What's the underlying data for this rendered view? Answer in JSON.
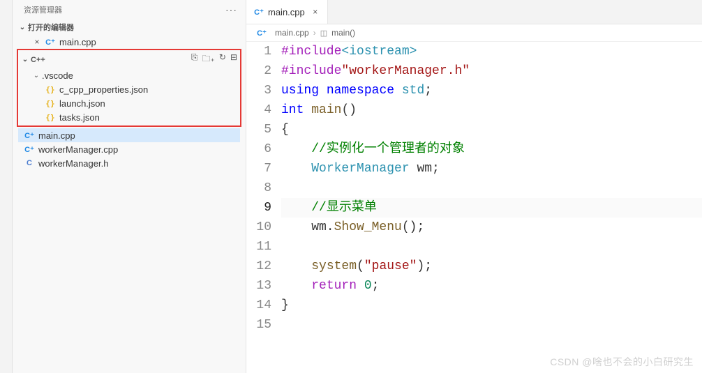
{
  "sidebar": {
    "title": "资源管理器",
    "open_editors_label": "打开的编辑器",
    "open_editor_file": "main.cpp",
    "project_name": "C++",
    "vscode_folder": ".vscode",
    "files": {
      "c_cpp_properties": "c_cpp_properties.json",
      "launch": "launch.json",
      "tasks": "tasks.json",
      "main": "main.cpp",
      "workerManagerCpp": "workerManager.cpp",
      "workerManagerH": "workerManager.h"
    }
  },
  "tab": {
    "file": "main.cpp"
  },
  "breadcrumb": {
    "file": "main.cpp",
    "symbol": "main()"
  },
  "code": {
    "lines": [
      {
        "n": 1,
        "tokens": [
          [
            "k-purple",
            "#include"
          ],
          [
            "k-teal",
            "<iostream>"
          ]
        ]
      },
      {
        "n": 2,
        "tokens": [
          [
            "k-purple",
            "#include"
          ],
          [
            "k-str",
            "\"workerManager.h\""
          ]
        ]
      },
      {
        "n": 3,
        "tokens": [
          [
            "k-blue",
            "using"
          ],
          [
            "",
            " "
          ],
          [
            "k-blue",
            "namespace"
          ],
          [
            "",
            " "
          ],
          [
            "k-teal",
            "std"
          ],
          [
            "",
            ";"
          ]
        ]
      },
      {
        "n": 4,
        "tokens": [
          [
            "k-blue",
            "int"
          ],
          [
            "",
            " "
          ],
          [
            "k-yellow",
            "main"
          ],
          [
            "",
            "()"
          ]
        ]
      },
      {
        "n": 5,
        "tokens": [
          [
            "",
            "{"
          ]
        ]
      },
      {
        "n": 6,
        "tokens": [
          [
            "",
            "    "
          ],
          [
            "k-green",
            "//实例化一个管理者的对象"
          ]
        ]
      },
      {
        "n": 7,
        "tokens": [
          [
            "",
            "    "
          ],
          [
            "k-teal",
            "WorkerManager"
          ],
          [
            "",
            " wm;"
          ]
        ]
      },
      {
        "n": 8,
        "tokens": [
          [
            "",
            ""
          ]
        ]
      },
      {
        "n": 9,
        "active": true,
        "tokens": [
          [
            "",
            "    "
          ],
          [
            "k-green",
            "//显示菜单"
          ]
        ]
      },
      {
        "n": 10,
        "tokens": [
          [
            "",
            "    wm."
          ],
          [
            "k-yellow",
            "Show_Menu"
          ],
          [
            "",
            "();"
          ]
        ]
      },
      {
        "n": 11,
        "tokens": [
          [
            "",
            ""
          ]
        ]
      },
      {
        "n": 12,
        "tokens": [
          [
            "",
            "    "
          ],
          [
            "k-yellow",
            "system"
          ],
          [
            "",
            "("
          ],
          [
            "k-str",
            "\"pause\""
          ],
          [
            "",
            ");"
          ]
        ]
      },
      {
        "n": 13,
        "tokens": [
          [
            "",
            "    "
          ],
          [
            "k-purple",
            "return"
          ],
          [
            "",
            " "
          ],
          [
            "k-num",
            "0"
          ],
          [
            "",
            ";"
          ]
        ]
      },
      {
        "n": 14,
        "tokens": [
          [
            "",
            "}"
          ]
        ]
      },
      {
        "n": 15,
        "tokens": [
          [
            "",
            ""
          ]
        ]
      }
    ]
  },
  "watermark": "CSDN @啥也不会的小白研究生"
}
